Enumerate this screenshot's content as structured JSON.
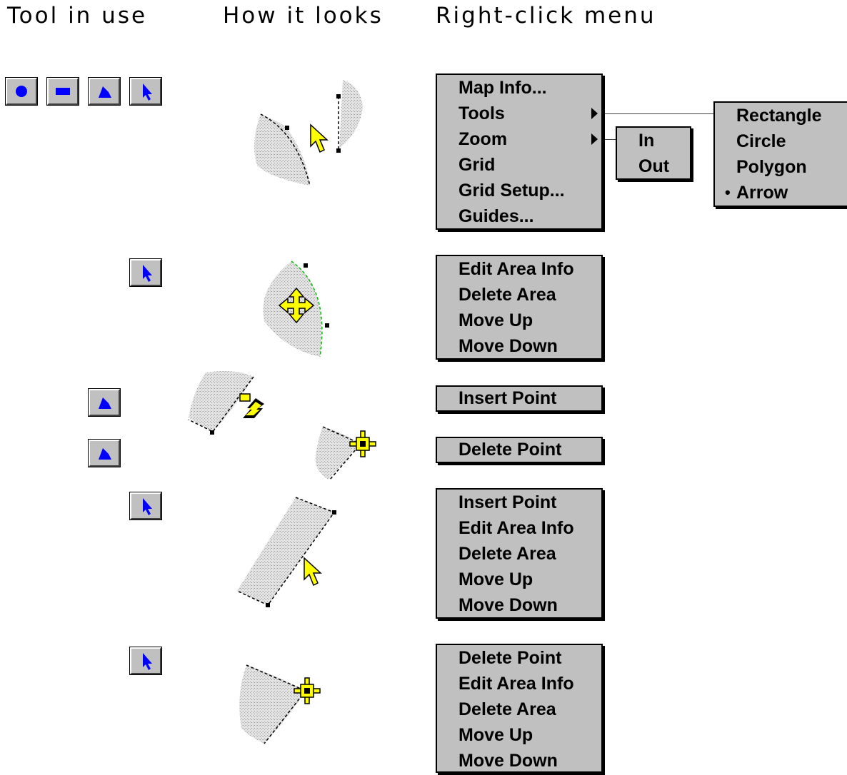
{
  "headers": {
    "tool": "Tool in use",
    "looks": "How it looks",
    "menu": "Right-click menu"
  },
  "toolbar_icons": [
    "circle-tool-icon",
    "rectangle-tool-icon",
    "polygon-tool-icon",
    "arrow-tool-icon"
  ],
  "menus": {
    "main": [
      "Map Info...",
      "Tools",
      "Zoom",
      "Grid",
      "Grid Setup...",
      "Guides..."
    ],
    "tools_submenu": [
      "Rectangle",
      "Circle",
      "Polygon",
      "Arrow"
    ],
    "tools_checked_marker": "•",
    "zoom_submenu": [
      "In",
      "Out"
    ],
    "area_select": [
      "Edit Area Info",
      "Delete Area",
      "Move Up",
      "Move Down"
    ],
    "polygon_edge": [
      "Insert Point"
    ],
    "polygon_vertex": [
      "Delete Point"
    ],
    "arrow_edge": [
      "Insert Point",
      "Edit Area Info",
      "Delete Area",
      "Move Up",
      "Move Down"
    ],
    "arrow_vertex": [
      "Delete Point",
      "Edit Area Info",
      "Delete Area",
      "Move Up",
      "Move Down"
    ]
  },
  "colors": {
    "menu_bg": "#c0c0c0",
    "icon_blue": "#0000ff",
    "cursor_yellow": "#ffff00",
    "area_gray": "#d4d4d4",
    "edge_green": "#00c000"
  }
}
